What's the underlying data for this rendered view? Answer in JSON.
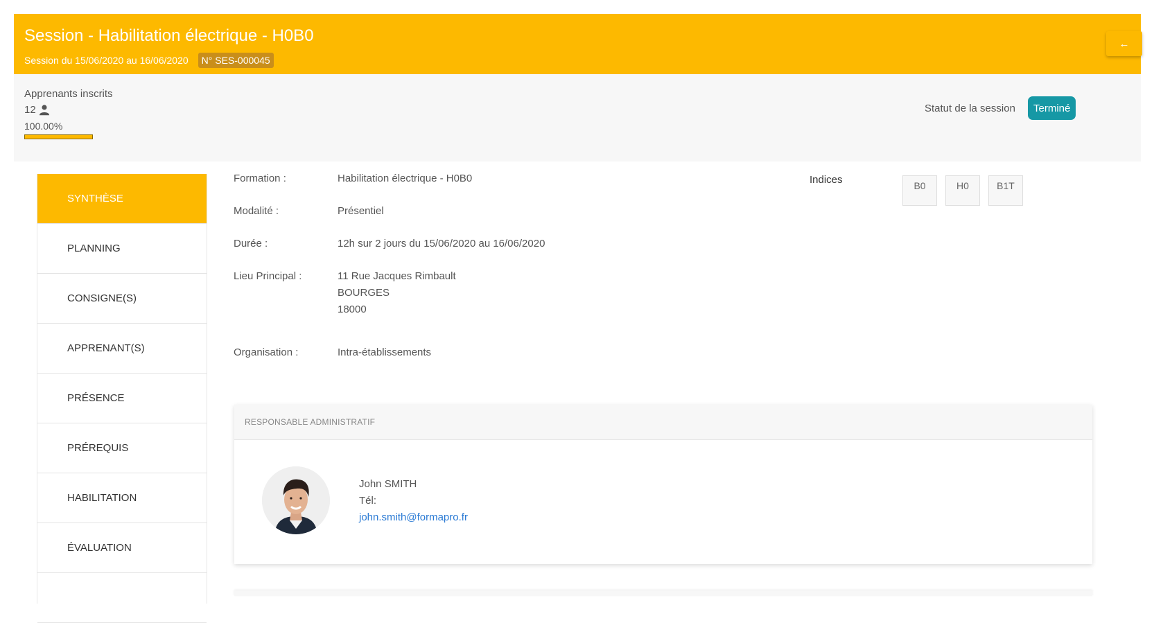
{
  "header": {
    "title": "Session - Habilitation électrique - H0B0",
    "subtitle": "Session du 15/06/2020 au 16/06/2020",
    "session_number": "N° SES-000045",
    "back_icon": "arrow-left-icon",
    "back_glyph": "←",
    "color": "#fdb900"
  },
  "stats": {
    "enrolled_label": "Apprenants inscrits",
    "enrolled_count": "12",
    "user_icon": "user-icon",
    "fill_percent_text": "100.00%",
    "fill_fraction": 1.0,
    "status_label": "Statut de la session",
    "status_value": "Terminé",
    "status_color": "#1698a5"
  },
  "sidebar": {
    "items": [
      {
        "label": "Synthèse",
        "active": true
      },
      {
        "label": "Planning",
        "active": false
      },
      {
        "label": "Consigne(s)",
        "active": false
      },
      {
        "label": "Apprenant(s)",
        "active": false
      },
      {
        "label": "Présence",
        "active": false
      },
      {
        "label": "Prérequis",
        "active": false
      },
      {
        "label": "Habilitation",
        "active": false
      },
      {
        "label": "Évaluation",
        "active": false
      },
      {
        "label": "",
        "active": false
      }
    ]
  },
  "details": {
    "formation_label": "Formation :",
    "formation_value": "Habilitation électrique - H0B0",
    "modalite_label": "Modalité :",
    "modalite_value": "Présentiel",
    "duree_label": "Durée :",
    "duree_value": "12h sur 2 jours du 15/06/2020 au 16/06/2020",
    "lieu_label": "Lieu Principal :",
    "lieu_street": "11 Rue Jacques Rimbault",
    "lieu_city": "BOURGES",
    "lieu_zip": "18000",
    "organisation_label": "Organisation :",
    "organisation_value": "Intra-établissements"
  },
  "indices": {
    "label": "Indices",
    "items": [
      "B0",
      "H0",
      "B1T"
    ]
  },
  "responsable": {
    "heading": "RESPONSABLE ADMINISTRATIF",
    "name": "John SMITH",
    "tel_label": "Tél:",
    "email": "john.smith@formapro.fr"
  }
}
